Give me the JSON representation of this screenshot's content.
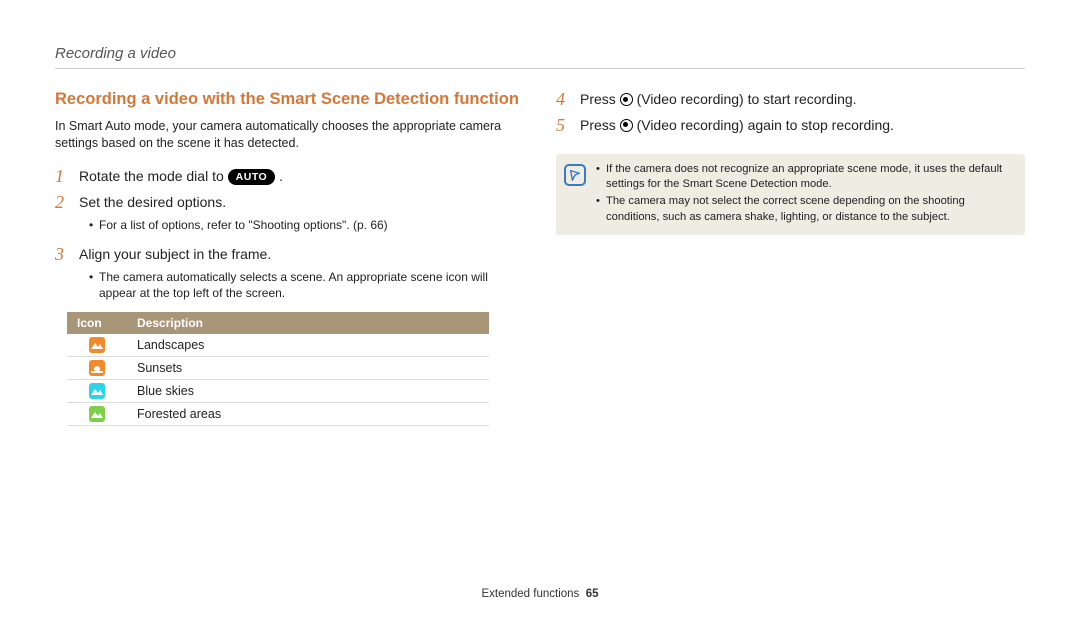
{
  "header": {
    "running_title": "Recording a video"
  },
  "left": {
    "section_title": "Recording a video with the Smart Scene Detection function",
    "intro": "In Smart Auto mode, your camera automatically chooses the appropriate camera settings based on the scene it has detected.",
    "steps": {
      "s1": {
        "num": "1",
        "pre": "Rotate the mode dial to ",
        "pill": "AUTO",
        "post": " ."
      },
      "s2": {
        "num": "2",
        "text": "Set the desired options.",
        "bullet": "For a list of options, refer to \"Shooting options\". (p. 66)"
      },
      "s3": {
        "num": "3",
        "text": "Align your subject in the frame.",
        "bullet": "The camera automatically selects a scene. An appropriate scene icon will appear at the top left of the screen."
      }
    },
    "table": {
      "headers": {
        "icon": "Icon",
        "desc": "Description"
      },
      "rows": [
        {
          "icon": "landscape-icon",
          "color": "sq-orange",
          "desc": "Landscapes"
        },
        {
          "icon": "sunset-icon",
          "color": "sq-orange",
          "desc": "Sunsets"
        },
        {
          "icon": "bluesky-icon",
          "color": "sq-cyan",
          "desc": "Blue skies"
        },
        {
          "icon": "forest-icon",
          "color": "sq-green",
          "desc": "Forested areas"
        }
      ]
    }
  },
  "right": {
    "steps": {
      "s4": {
        "num": "4",
        "pre": "Press ",
        "post": " (Video recording) to start recording."
      },
      "s5": {
        "num": "5",
        "pre": "Press ",
        "post": " (Video recording) again to stop recording."
      }
    },
    "note": {
      "items": [
        "If the camera does not recognize an appropriate scene mode, it uses the default settings for the Smart Scene Detection mode.",
        "The camera may not select the correct scene depending on the shooting conditions, such as camera shake, lighting, or distance to the subject."
      ]
    }
  },
  "footer": {
    "section": "Extended functions",
    "page": "65"
  }
}
